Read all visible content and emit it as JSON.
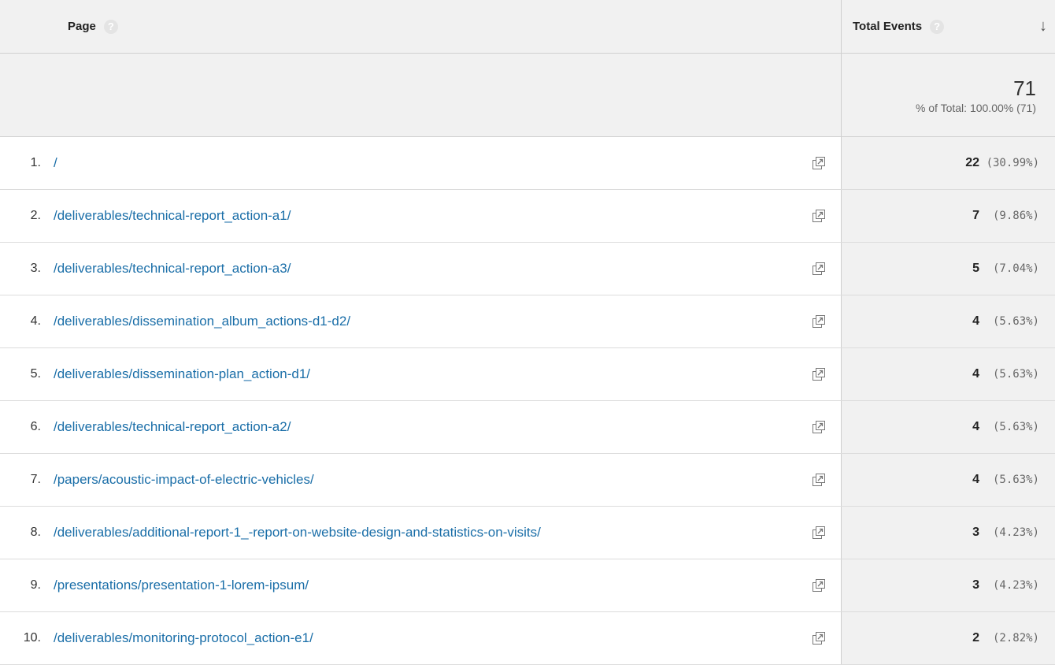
{
  "header": {
    "page_label": "Page",
    "events_label": "Total Events",
    "help_glyph": "?",
    "sort_glyph": "↓"
  },
  "totals": {
    "value": "71",
    "pct_text": "% of Total: 100.00% (71)"
  },
  "rows": [
    {
      "index": "1.",
      "page": "/",
      "value": "22",
      "pct": "(30.99%)"
    },
    {
      "index": "2.",
      "page": "/deliverables/technical-report_action-a1/",
      "value": "7",
      "pct": "(9.86%)"
    },
    {
      "index": "3.",
      "page": "/deliverables/technical-report_action-a3/",
      "value": "5",
      "pct": "(7.04%)"
    },
    {
      "index": "4.",
      "page": "/deliverables/dissemination_album_actions-d1-d2/",
      "value": "4",
      "pct": "(5.63%)"
    },
    {
      "index": "5.",
      "page": "/deliverables/dissemination-plan_action-d1/",
      "value": "4",
      "pct": "(5.63%)"
    },
    {
      "index": "6.",
      "page": "/deliverables/technical-report_action-a2/",
      "value": "4",
      "pct": "(5.63%)"
    },
    {
      "index": "7.",
      "page": "/papers/acoustic-impact-of-electric-vehicles/",
      "value": "4",
      "pct": "(5.63%)"
    },
    {
      "index": "8.",
      "page": "/deliverables/additional-report-1_-report-on-website-design-and-statistics-on-visits/",
      "value": "3",
      "pct": "(4.23%)"
    },
    {
      "index": "9.",
      "page": "/presentations/presentation-1-lorem-ipsum/",
      "value": "3",
      "pct": "(4.23%)"
    },
    {
      "index": "10.",
      "page": "/deliverables/monitoring-protocol_action-e1/",
      "value": "2",
      "pct": "(2.82%)"
    }
  ],
  "icons": {
    "help": "help-circle-icon",
    "sort": "sort-descending-arrow-icon",
    "row_action": "open-in-new-window-icon"
  },
  "colors": {
    "link": "#1a6ea8",
    "header_bg": "#f1f1f1"
  }
}
